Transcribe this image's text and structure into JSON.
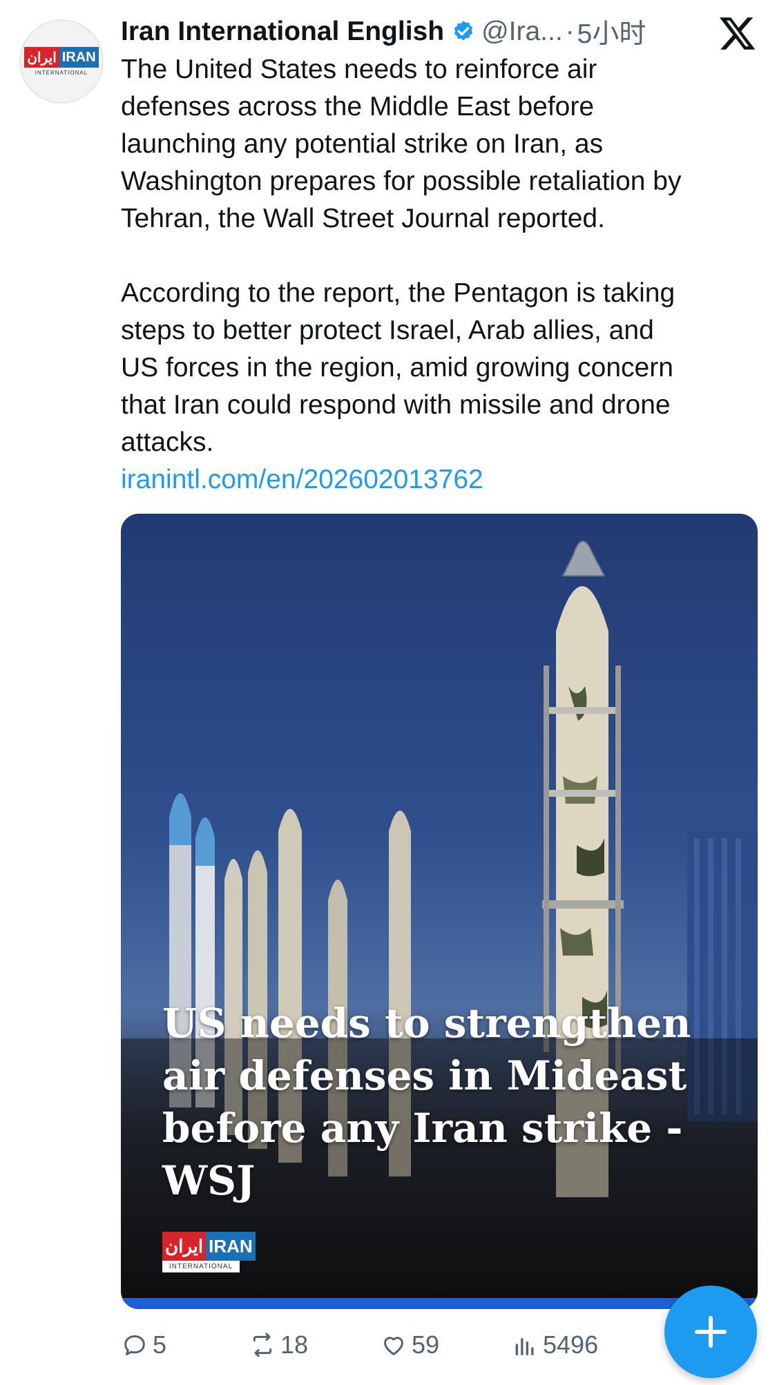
{
  "tweet": {
    "author_name": "Iran International English",
    "handle": "@Ira...",
    "separator": "·",
    "timestamp": "5小时",
    "avatar_logo": {
      "persian": "ایران",
      "latin": "IRAN",
      "sub": "INTERNATIONAL"
    },
    "paragraph_1": "The United States needs to reinforce air\ndefenses across the Middle East before\nlaunching any potential strike on Iran, as\nWashington prepares for possible retaliation by\nTehran, the Wall Street Journal reported.",
    "paragraph_2": "According to the report, the Pentagon is taking\nsteps to better protect Israel, Arab allies, and\nUS forces in the region, amid growing concern\nthat Iran could respond with missile and drone\nattacks.",
    "link": "iranintl.com/en/202602013762"
  },
  "media": {
    "headline": "US needs to strengthen air defenses in Mideast before any Iran strike - WSJ",
    "logo": {
      "persian": "ایران",
      "latin": "IRAN",
      "sub": "INTERNATIONAL"
    }
  },
  "actions": {
    "replies": "5",
    "reposts": "18",
    "likes": "59",
    "views": "5496"
  },
  "colors": {
    "accent": "#1d9bf0",
    "text": "#0f1419",
    "muted": "#536471",
    "logo_red": "#d8232a",
    "logo_blue": "#1b6fb5"
  },
  "icons": {
    "verified": "verified-badge-icon",
    "x_logo": "x-logo-icon",
    "reply": "reply-icon",
    "repost": "repost-icon",
    "like": "heart-icon",
    "views": "views-icon",
    "compose": "plus-icon"
  }
}
